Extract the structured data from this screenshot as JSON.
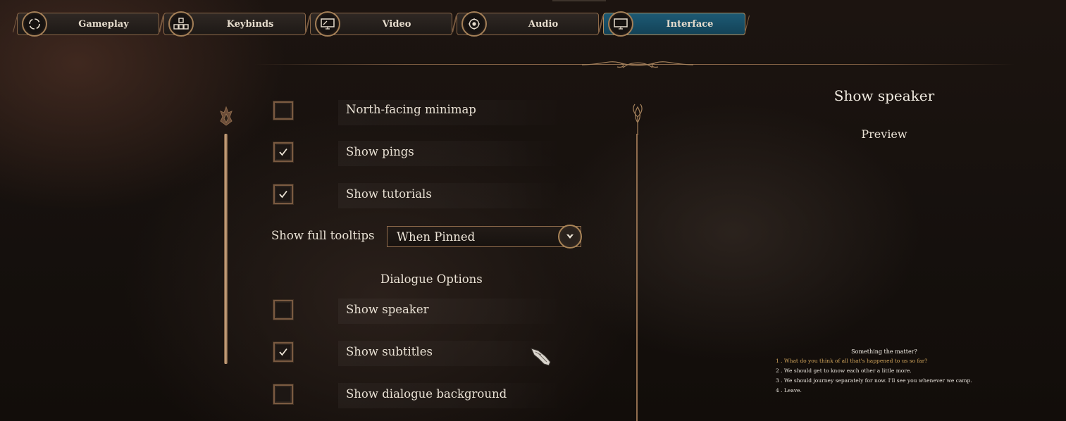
{
  "tabs": [
    {
      "label": "Gameplay",
      "icon": "gameplay-icon",
      "active": false
    },
    {
      "label": "Keybinds",
      "icon": "keybinds-icon",
      "active": false
    },
    {
      "label": "Video",
      "icon": "video-icon",
      "active": false
    },
    {
      "label": "Audio",
      "icon": "audio-icon",
      "active": false
    },
    {
      "label": "Interface",
      "icon": "interface-icon",
      "active": true
    }
  ],
  "settings": {
    "north_facing_minimap": {
      "label": "North-facing minimap",
      "checked": false
    },
    "show_pings": {
      "label": "Show pings",
      "checked": true
    },
    "show_tutorials": {
      "label": "Show tutorials",
      "checked": true
    },
    "show_full_tooltips": {
      "label": "Show full tooltips",
      "value": "When Pinned"
    },
    "dialogue_section": "Dialogue Options",
    "show_speaker": {
      "label": "Show speaker",
      "checked": false
    },
    "show_subtitles": {
      "label": "Show subtitles",
      "checked": true
    },
    "show_dialogue_background": {
      "label": "Show dialogue background",
      "checked": false
    }
  },
  "preview": {
    "title": "Show speaker",
    "subtitle": "Preview",
    "question": "Something the matter?",
    "options": [
      "1 . What do you think of all that's happened to us so far?",
      "2 . We should get to know each other a little more.",
      "3 . We should journey separately for now. I'll see you whenever we camp.",
      "4 . Leave."
    ]
  },
  "colors": {
    "active_tab": "#1d5a74",
    "gold_trim": "#a37f57",
    "highlight_option": "#d2a55c"
  }
}
